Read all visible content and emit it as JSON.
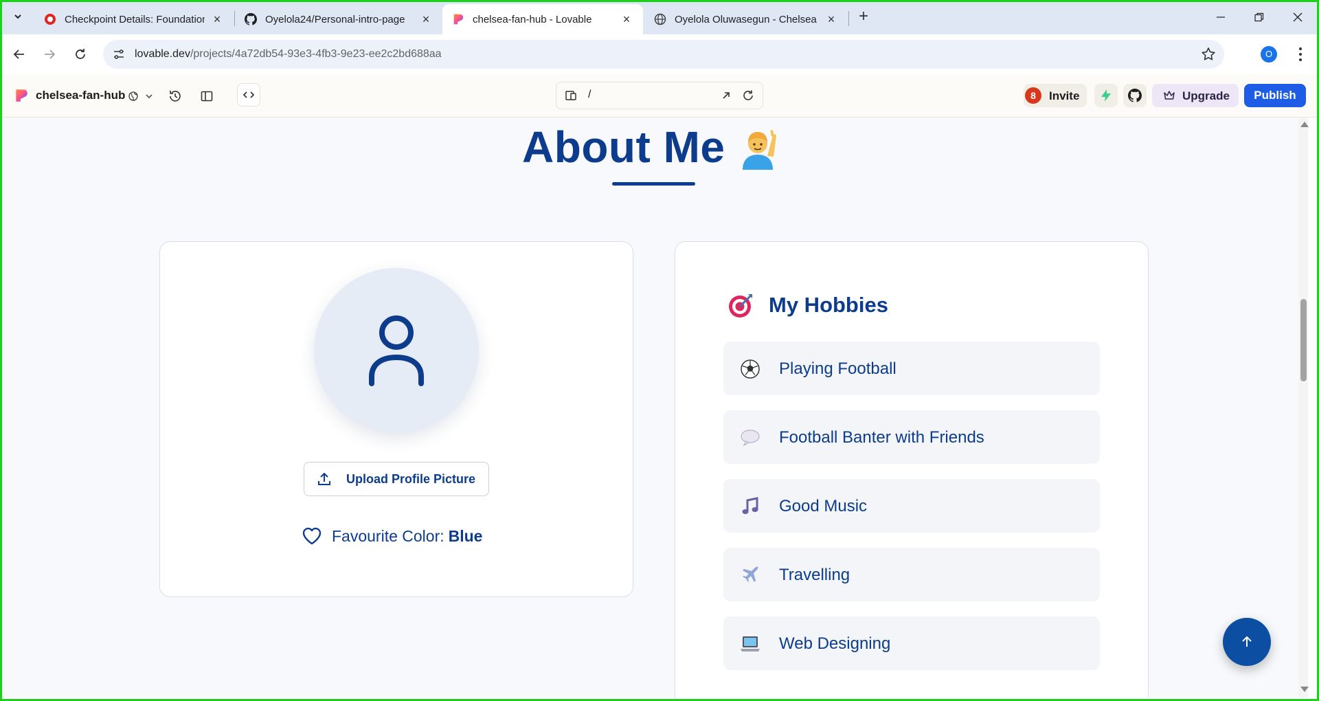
{
  "browser": {
    "tabs": [
      {
        "title": "Checkpoint Details: Foundation",
        "favicon": "red-o-icon",
        "active": false
      },
      {
        "title": "Oyelola24/Personal-intro-page",
        "favicon": "github-icon",
        "active": false
      },
      {
        "title": "chelsea-fan-hub - Lovable",
        "favicon": "lovable-heart-icon",
        "active": true
      },
      {
        "title": "Oyelola Oluwasegun - Chelsea F",
        "favicon": "globe-icon",
        "active": false
      }
    ],
    "url_host": "lovable.dev",
    "url_path": "/projects/4a72db54-93e3-4fb3-9e23-ee2c2bd688aa",
    "profile_initial": "O"
  },
  "lovable": {
    "project_name": "chelsea-fan-hub",
    "route": "/",
    "invite_badge": "8",
    "invite_label": "Invite",
    "upgrade_label": "Upgrade",
    "publish_label": "Publish"
  },
  "page": {
    "about_title": "About Me",
    "upload_label": "Upload Profile Picture",
    "favourite_color_label": "Favourite Color:",
    "favourite_color_value": "Blue",
    "hobbies_title": "My Hobbies",
    "hobbies": [
      {
        "label": "Playing Football",
        "icon": "soccer-ball-icon"
      },
      {
        "label": "Football Banter with Friends",
        "icon": "speech-bubble-icon"
      },
      {
        "label": "Good Music",
        "icon": "music-note-icon"
      },
      {
        "label": "Travelling",
        "icon": "airplane-icon"
      },
      {
        "label": "Web Designing",
        "icon": "laptop-icon"
      }
    ]
  },
  "colors": {
    "brand_navy": "#0c3c8b",
    "publish_blue": "#1f5ce6",
    "frame_green": "#19d219"
  }
}
